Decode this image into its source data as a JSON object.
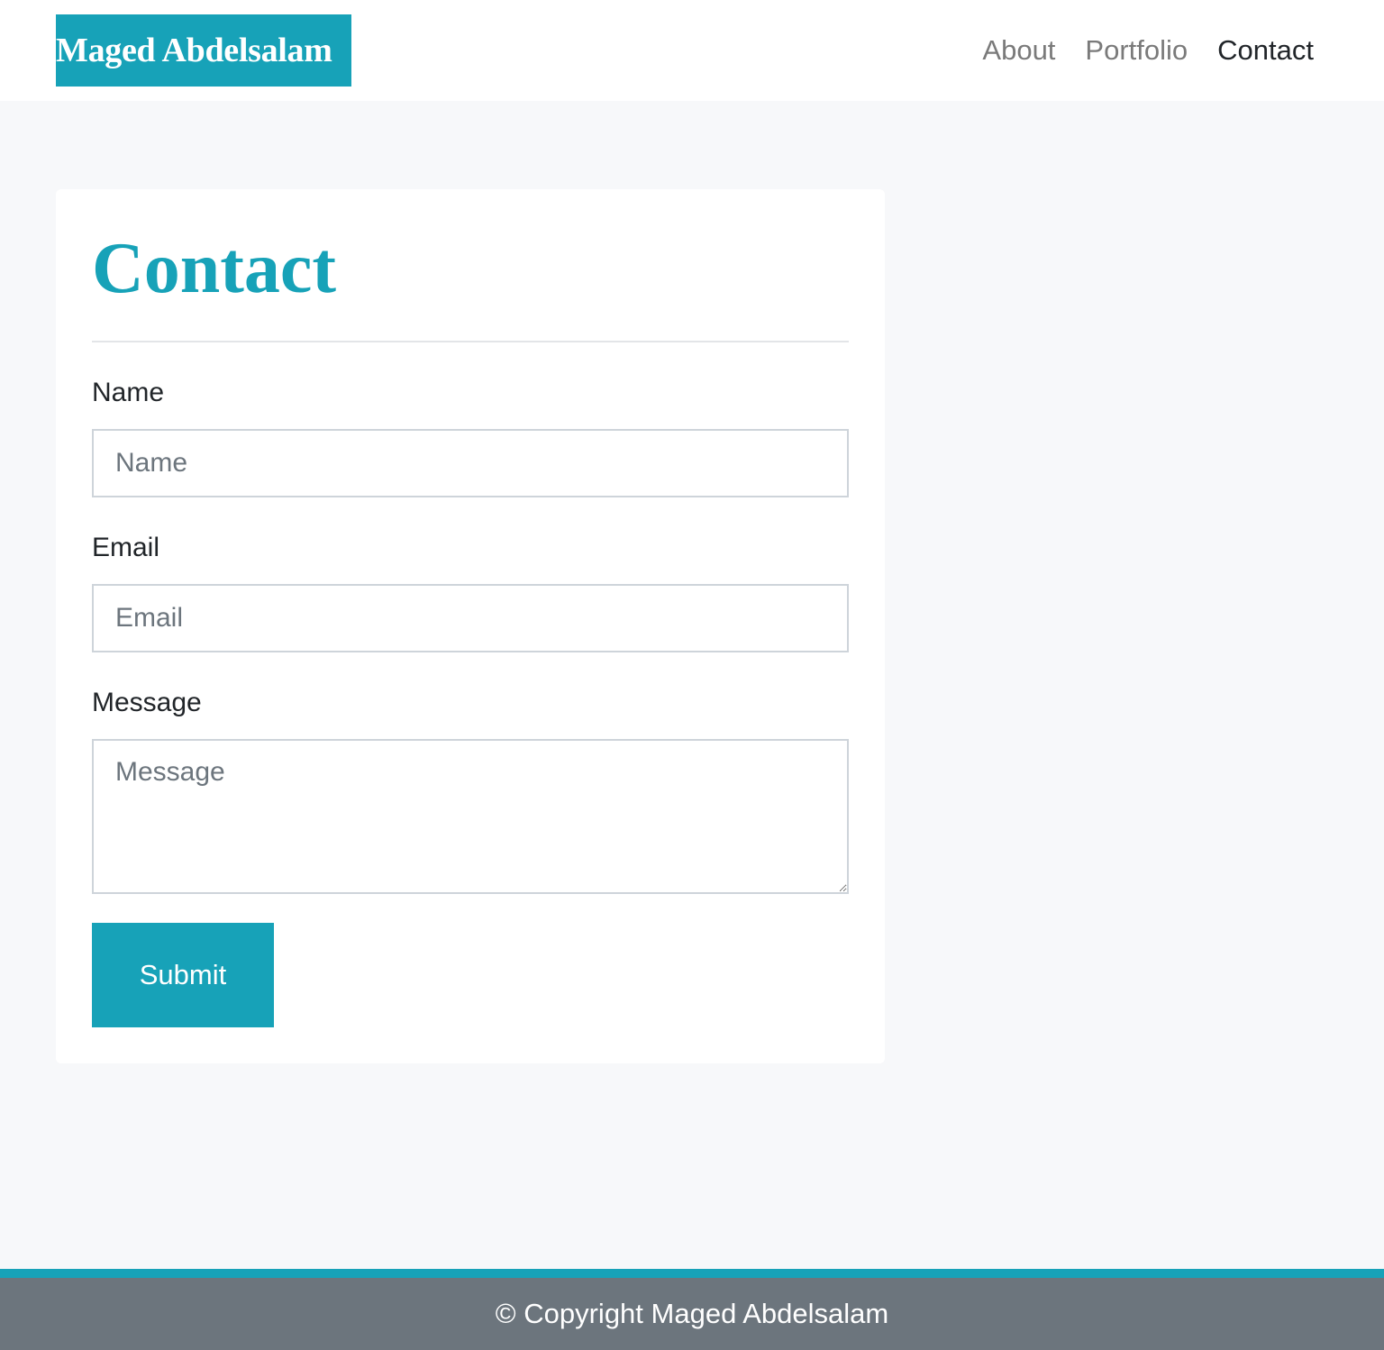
{
  "header": {
    "brand": "Maged Abdelsalam",
    "nav": [
      {
        "label": "About",
        "active": false
      },
      {
        "label": "Portfolio",
        "active": false
      },
      {
        "label": "Contact",
        "active": true
      }
    ]
  },
  "contact": {
    "title": "Contact",
    "fields": {
      "name": {
        "label": "Name",
        "placeholder": "Name",
        "value": ""
      },
      "email": {
        "label": "Email",
        "placeholder": "Email",
        "value": ""
      },
      "message": {
        "label": "Message",
        "placeholder": "Message",
        "value": ""
      }
    },
    "submit_label": "Submit"
  },
  "footer": {
    "copyright": "© Copyright Maged Abdelsalam"
  },
  "colors": {
    "accent": "#17a2b8",
    "footer_bg": "#6c757d",
    "page_bg": "#f7f8fa"
  }
}
